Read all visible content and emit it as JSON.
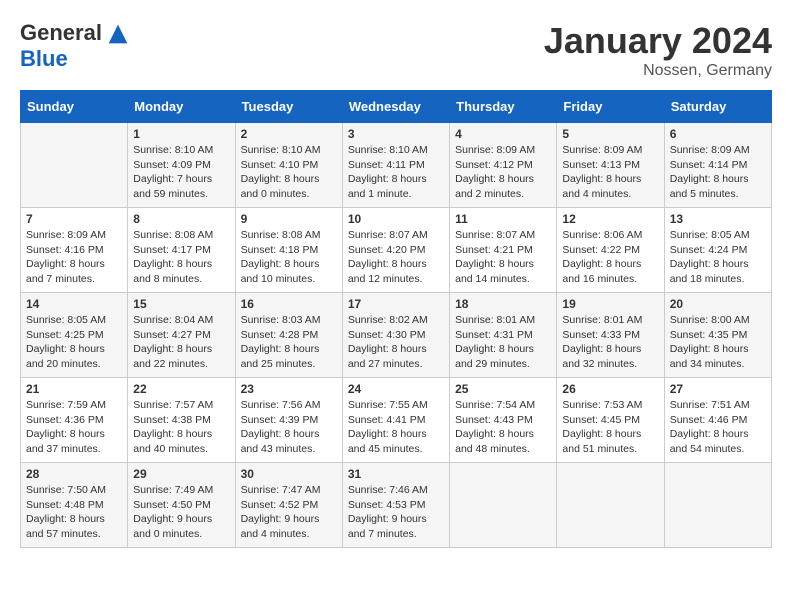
{
  "header": {
    "logo_general": "General",
    "logo_blue": "Blue",
    "month_title": "January 2024",
    "location": "Nossen, Germany"
  },
  "weekdays": [
    "Sunday",
    "Monday",
    "Tuesday",
    "Wednesday",
    "Thursday",
    "Friday",
    "Saturday"
  ],
  "weeks": [
    [
      {
        "day": "",
        "info": ""
      },
      {
        "day": "1",
        "info": "Sunrise: 8:10 AM\nSunset: 4:09 PM\nDaylight: 7 hours and 59 minutes."
      },
      {
        "day": "2",
        "info": "Sunrise: 8:10 AM\nSunset: 4:10 PM\nDaylight: 8 hours and 0 minutes."
      },
      {
        "day": "3",
        "info": "Sunrise: 8:10 AM\nSunset: 4:11 PM\nDaylight: 8 hours and 1 minute."
      },
      {
        "day": "4",
        "info": "Sunrise: 8:09 AM\nSunset: 4:12 PM\nDaylight: 8 hours and 2 minutes."
      },
      {
        "day": "5",
        "info": "Sunrise: 8:09 AM\nSunset: 4:13 PM\nDaylight: 8 hours and 4 minutes."
      },
      {
        "day": "6",
        "info": "Sunrise: 8:09 AM\nSunset: 4:14 PM\nDaylight: 8 hours and 5 minutes."
      }
    ],
    [
      {
        "day": "7",
        "info": "Sunrise: 8:09 AM\nSunset: 4:16 PM\nDaylight: 8 hours and 7 minutes."
      },
      {
        "day": "8",
        "info": "Sunrise: 8:08 AM\nSunset: 4:17 PM\nDaylight: 8 hours and 8 minutes."
      },
      {
        "day": "9",
        "info": "Sunrise: 8:08 AM\nSunset: 4:18 PM\nDaylight: 8 hours and 10 minutes."
      },
      {
        "day": "10",
        "info": "Sunrise: 8:07 AM\nSunset: 4:20 PM\nDaylight: 8 hours and 12 minutes."
      },
      {
        "day": "11",
        "info": "Sunrise: 8:07 AM\nSunset: 4:21 PM\nDaylight: 8 hours and 14 minutes."
      },
      {
        "day": "12",
        "info": "Sunrise: 8:06 AM\nSunset: 4:22 PM\nDaylight: 8 hours and 16 minutes."
      },
      {
        "day": "13",
        "info": "Sunrise: 8:05 AM\nSunset: 4:24 PM\nDaylight: 8 hours and 18 minutes."
      }
    ],
    [
      {
        "day": "14",
        "info": "Sunrise: 8:05 AM\nSunset: 4:25 PM\nDaylight: 8 hours and 20 minutes."
      },
      {
        "day": "15",
        "info": "Sunrise: 8:04 AM\nSunset: 4:27 PM\nDaylight: 8 hours and 22 minutes."
      },
      {
        "day": "16",
        "info": "Sunrise: 8:03 AM\nSunset: 4:28 PM\nDaylight: 8 hours and 25 minutes."
      },
      {
        "day": "17",
        "info": "Sunrise: 8:02 AM\nSunset: 4:30 PM\nDaylight: 8 hours and 27 minutes."
      },
      {
        "day": "18",
        "info": "Sunrise: 8:01 AM\nSunset: 4:31 PM\nDaylight: 8 hours and 29 minutes."
      },
      {
        "day": "19",
        "info": "Sunrise: 8:01 AM\nSunset: 4:33 PM\nDaylight: 8 hours and 32 minutes."
      },
      {
        "day": "20",
        "info": "Sunrise: 8:00 AM\nSunset: 4:35 PM\nDaylight: 8 hours and 34 minutes."
      }
    ],
    [
      {
        "day": "21",
        "info": "Sunrise: 7:59 AM\nSunset: 4:36 PM\nDaylight: 8 hours and 37 minutes."
      },
      {
        "day": "22",
        "info": "Sunrise: 7:57 AM\nSunset: 4:38 PM\nDaylight: 8 hours and 40 minutes."
      },
      {
        "day": "23",
        "info": "Sunrise: 7:56 AM\nSunset: 4:39 PM\nDaylight: 8 hours and 43 minutes."
      },
      {
        "day": "24",
        "info": "Sunrise: 7:55 AM\nSunset: 4:41 PM\nDaylight: 8 hours and 45 minutes."
      },
      {
        "day": "25",
        "info": "Sunrise: 7:54 AM\nSunset: 4:43 PM\nDaylight: 8 hours and 48 minutes."
      },
      {
        "day": "26",
        "info": "Sunrise: 7:53 AM\nSunset: 4:45 PM\nDaylight: 8 hours and 51 minutes."
      },
      {
        "day": "27",
        "info": "Sunrise: 7:51 AM\nSunset: 4:46 PM\nDaylight: 8 hours and 54 minutes."
      }
    ],
    [
      {
        "day": "28",
        "info": "Sunrise: 7:50 AM\nSunset: 4:48 PM\nDaylight: 8 hours and 57 minutes."
      },
      {
        "day": "29",
        "info": "Sunrise: 7:49 AM\nSunset: 4:50 PM\nDaylight: 9 hours and 0 minutes."
      },
      {
        "day": "30",
        "info": "Sunrise: 7:47 AM\nSunset: 4:52 PM\nDaylight: 9 hours and 4 minutes."
      },
      {
        "day": "31",
        "info": "Sunrise: 7:46 AM\nSunset: 4:53 PM\nDaylight: 9 hours and 7 minutes."
      },
      {
        "day": "",
        "info": ""
      },
      {
        "day": "",
        "info": ""
      },
      {
        "day": "",
        "info": ""
      }
    ]
  ]
}
